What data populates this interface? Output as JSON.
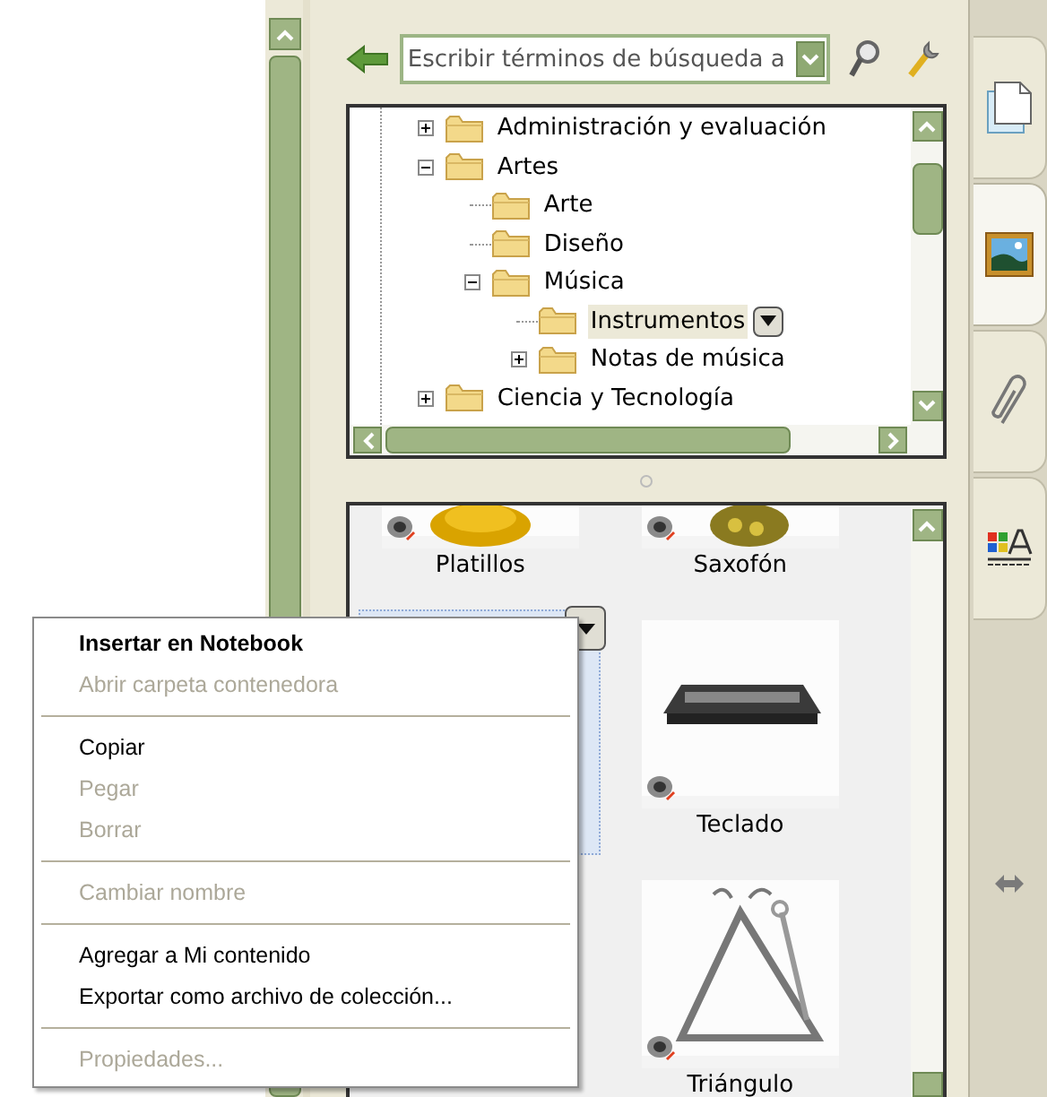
{
  "search": {
    "placeholder": "Escribir términos de búsqueda a"
  },
  "tree": [
    {
      "label": "Administración y evaluación",
      "expanded": false,
      "selected": false
    },
    {
      "label": "Artes",
      "expanded": true,
      "selected": false,
      "children": [
        {
          "label": "Arte",
          "selected": false
        },
        {
          "label": "Diseño",
          "selected": false
        },
        {
          "label": "Música",
          "expanded": true,
          "selected": false,
          "children": [
            {
              "label": "Instrumentos",
              "selected": true
            },
            {
              "label": "Notas de música",
              "expanded": false,
              "selected": false
            }
          ]
        }
      ]
    },
    {
      "label": "Ciencia y Tecnología",
      "expanded": false,
      "selected": false
    }
  ],
  "gallery": {
    "columns": [
      [
        {
          "label": "Platillos",
          "selected": false
        },
        {
          "selected": true
        }
      ],
      [
        {
          "label": "Saxofón",
          "selected": false
        },
        {
          "label": "Teclado",
          "selected": false
        },
        {
          "label": "Triángulo",
          "selected": false
        }
      ]
    ]
  },
  "side_tabs": [
    {
      "kind": "page",
      "selected": false
    },
    {
      "kind": "gallery",
      "selected": true
    },
    {
      "kind": "attachments",
      "selected": false
    },
    {
      "kind": "properties",
      "selected": false
    }
  ],
  "context_menu": [
    {
      "kind": "default",
      "label": "Insertar en Notebook",
      "disabled": false
    },
    {
      "kind": "item",
      "label": "Abrir carpeta contenedora",
      "disabled": true
    },
    {
      "kind": "separator"
    },
    {
      "kind": "item",
      "label": "Copiar",
      "disabled": false
    },
    {
      "kind": "item",
      "label": "Pegar",
      "disabled": true
    },
    {
      "kind": "item",
      "label": "Borrar",
      "disabled": true
    },
    {
      "kind": "separator"
    },
    {
      "kind": "item",
      "label": "Cambiar nombre",
      "disabled": true
    },
    {
      "kind": "separator"
    },
    {
      "kind": "item",
      "label": "Agregar a Mi contenido",
      "disabled": false
    },
    {
      "kind": "item",
      "label": "Exportar como archivo de colección...",
      "disabled": false
    },
    {
      "kind": "separator"
    },
    {
      "kind": "item",
      "label": "Propiedades...",
      "disabled": true
    }
  ]
}
